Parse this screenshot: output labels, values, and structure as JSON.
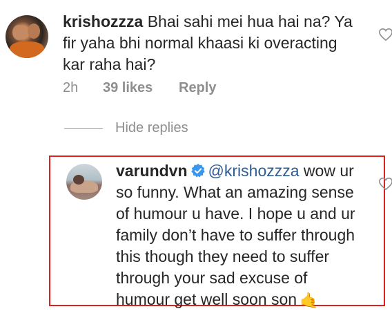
{
  "comments": [
    {
      "username": "krishozzza",
      "text": "Bhai sahi mei hua hai na? Ya fir yaha bhi normal khaasi ki overacting kar raha hai?",
      "time": "2h",
      "likes": "39 likes",
      "reply_label": "Reply",
      "hide_replies_label": "Hide replies"
    },
    {
      "username": "varundvn",
      "verified": true,
      "mention": "@krishozzza",
      "text": "wow ur so funny. What an amazing sense of humour u have. I hope u and ur family don’t have to suffer through this though they need to suffer through your sad excuse of humour get well soon son",
      "emoji": "🤙",
      "highlight_color": "#e0201c"
    }
  ],
  "colors": {
    "text": "#262626",
    "muted": "#8e8e8e",
    "mention": "#2f5d96",
    "verified": "#3897f0"
  }
}
